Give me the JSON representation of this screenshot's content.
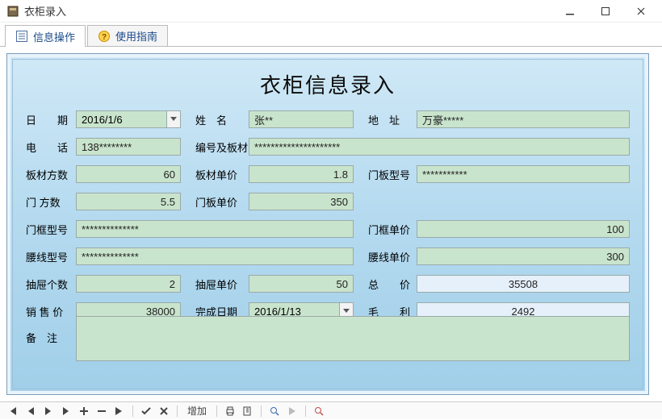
{
  "window": {
    "title": "衣柜录入"
  },
  "tabs": {
    "info": "信息操作",
    "guide": "使用指南"
  },
  "form": {
    "title": "衣柜信息录入",
    "labels": {
      "date": "日　　期",
      "name": "姓　名",
      "addr": "地　址",
      "phone": "电　　话",
      "codeMat": "编号及板材",
      "boardQty": "板材方数",
      "boardPrice": "板材单价",
      "doorModel": "门板型号",
      "doorQty": "门 方数",
      "doorPrice": "门板单价",
      "frameModel": "门框型号",
      "framePrice": "门框单价",
      "waistModel": "腰线型号",
      "waistPrice": "腰线单价",
      "drawerCount": "抽屉个数",
      "drawerPrice": "抽屉单价",
      "total": "总　　价",
      "salePrice": "销 售 价",
      "finishDate": "完成日期",
      "profit": "毛　　利",
      "remarks": "备　注"
    },
    "values": {
      "date": "2016/1/6",
      "name": "张**",
      "addr": "万豪*****",
      "phone": "138********",
      "codeMat": "*********************",
      "boardQty": "60",
      "boardPrice": "1.8",
      "doorModel": "***********",
      "doorQty": "5.5",
      "doorPrice": "350",
      "frameModel": "**************",
      "framePrice": "100",
      "waistModel": "**************",
      "waistPrice": "300",
      "drawerCount": "2",
      "drawerPrice": "50",
      "total": "35508",
      "salePrice": "38000",
      "finishDate": "2016/1/13",
      "profit": "2492",
      "remarks": ""
    }
  },
  "toolbar": {
    "add": "增加"
  }
}
